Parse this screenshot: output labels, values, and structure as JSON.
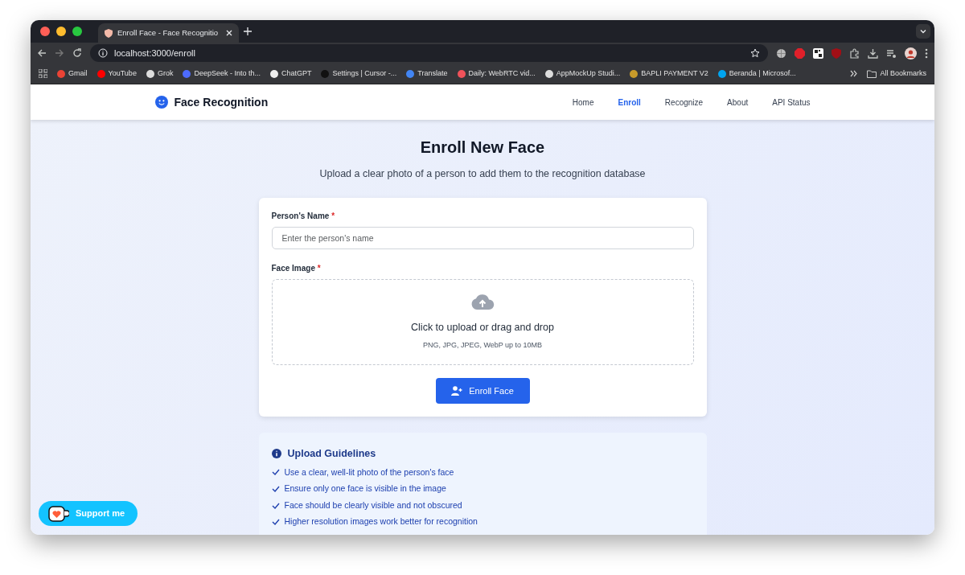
{
  "browser": {
    "tab_title": "Enroll Face - Face Recognitio",
    "url": "localhost:3000/enroll",
    "bookmarks": [
      {
        "label": "Gmail"
      },
      {
        "label": "YouTube"
      },
      {
        "label": "Grok"
      },
      {
        "label": "DeepSeek - Into th..."
      },
      {
        "label": "ChatGPT"
      },
      {
        "label": "Settings | Cursor -..."
      },
      {
        "label": "Translate"
      },
      {
        "label": "Daily: WebRTC vid..."
      },
      {
        "label": "AppMockUp Studi..."
      },
      {
        "label": "BAPLI PAYMENT V2"
      },
      {
        "label": "Beranda | Microsof..."
      }
    ],
    "all_bookmarks": "All Bookmarks"
  },
  "navbar": {
    "brand": "Face Recognition",
    "links": [
      {
        "label": "Home",
        "selected": false
      },
      {
        "label": "Enroll",
        "selected": true
      },
      {
        "label": "Recognize",
        "selected": false
      },
      {
        "label": "About",
        "selected": false
      },
      {
        "label": "API Status",
        "selected": false
      }
    ]
  },
  "heading": "Enroll New Face",
  "subtitle": "Upload a clear photo of a person to add them to the recognition database",
  "form": {
    "name_label": "Person's Name",
    "name_required": "*",
    "name_placeholder": "Enter the person's name",
    "image_label": "Face Image",
    "image_required": "*",
    "upload_text": "Click to upload or drag and drop",
    "upload_hint": "PNG, JPG, JPEG, WebP up to 10MB",
    "submit": "Enroll Face"
  },
  "guidelines": {
    "title": "Upload Guidelines",
    "items": [
      "Use a clear, well-lit photo of the person's face",
      "Ensure only one face is visible in the image",
      "Face should be clearly visible and not obscured",
      "Higher resolution images work better for recognition"
    ]
  },
  "support": "Support me"
}
